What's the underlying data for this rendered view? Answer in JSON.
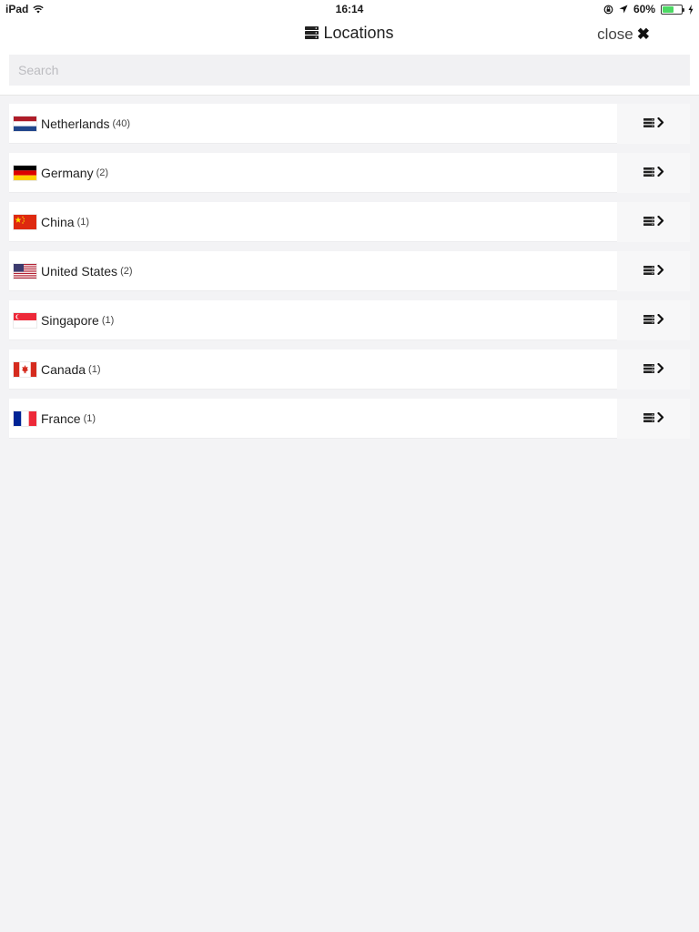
{
  "status_bar": {
    "device": "iPad",
    "time": "16:14",
    "battery": "60%",
    "battery_level": 0.6
  },
  "header": {
    "title": "Locations",
    "close_label": "close",
    "close_icon": "✖"
  },
  "search": {
    "placeholder": "Search",
    "value": ""
  },
  "locations": [
    {
      "country": "Netherlands",
      "count": "(40)"
    },
    {
      "country": "Germany",
      "count": "(2)"
    },
    {
      "country": "China",
      "count": "(1)"
    },
    {
      "country": "United States",
      "count": "(2)"
    },
    {
      "country": "Singapore",
      "count": "(1)"
    },
    {
      "country": "Canada",
      "count": "(1)"
    },
    {
      "country": "France",
      "count": "(1)"
    }
  ],
  "colors": {
    "background": "#f3f3f5",
    "row": "#ffffff",
    "battery": "#4cd964"
  }
}
